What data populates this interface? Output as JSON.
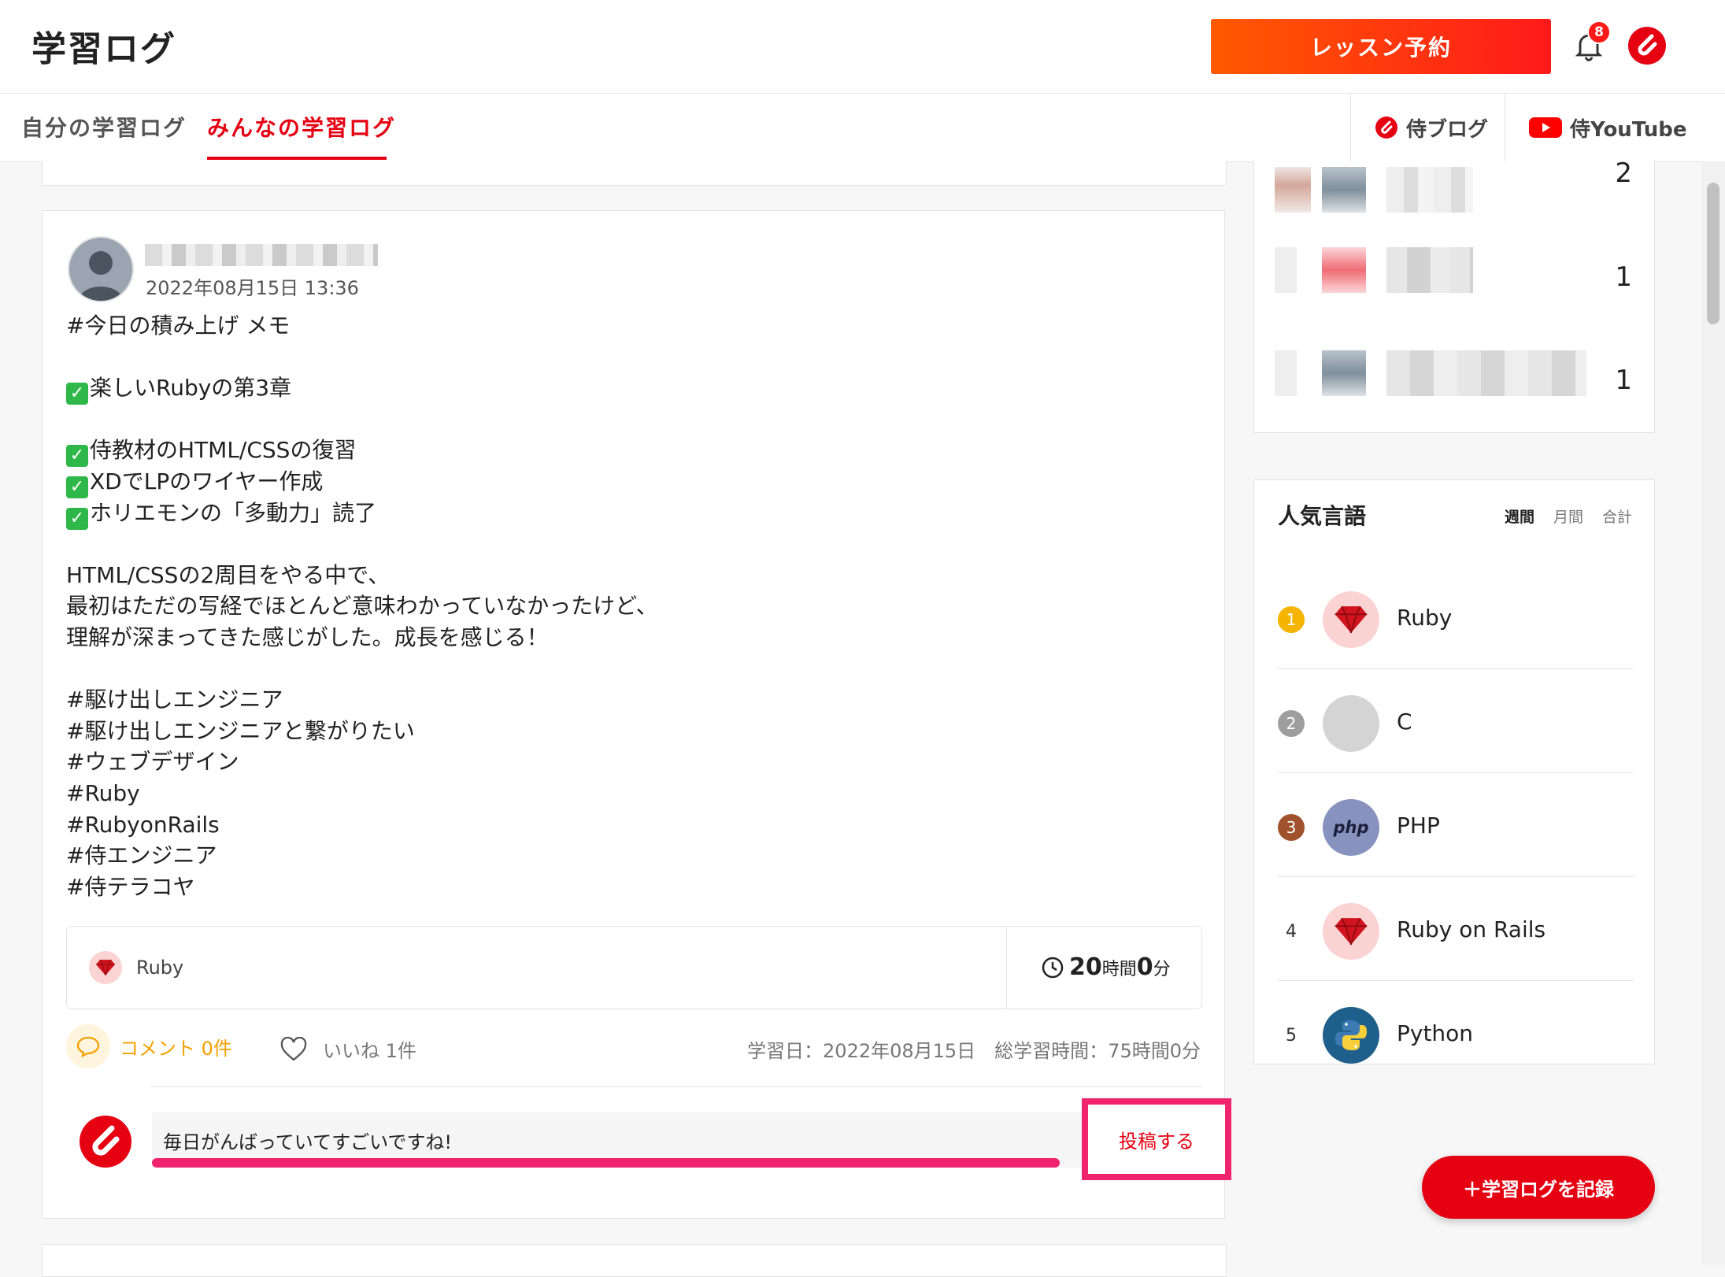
{
  "header": {
    "title": "学習ログ",
    "reserve_button": "レッスン予約",
    "notification_count": "8"
  },
  "tabs": {
    "mine": "自分の学習ログ",
    "everyone": "みんなの学習ログ",
    "active": "everyone"
  },
  "external_links": {
    "blog": "侍ブログ",
    "youtube": "侍YouTube"
  },
  "post": {
    "date": "2022年08月15日 13:36",
    "lines": [
      "#今日の積み上げ メモ",
      "",
      "✅楽しいRubyの第3章",
      "",
      "✅侍教材のHTML/CSSの復習",
      "✅XDでLPのワイヤー作成",
      "✅ホリエモンの「多動力」読了",
      "",
      "HTML/CSSの2周目をやる中で、",
      "最初はただの写経でほとんど意味わかっていなかったけど、",
      "理解が深まってきた感じがした。成長を感じる！",
      "",
      "#駆け出しエンジニア",
      "#駆け出しエンジニアと繋がりたい",
      "#ウェブデザイン",
      "#Ruby",
      "#RubyonRails",
      "#侍エンジニア",
      "#侍テラコヤ"
    ],
    "language": "Ruby",
    "duration_hours": "20",
    "duration_hours_unit": "時間",
    "duration_minutes": "0",
    "duration_minutes_unit": "分",
    "comment_label": "コメント 0件",
    "like_label": "いいね 1件",
    "study_meta": "学習日：2022年08月15日　総学習時間：75時間0分"
  },
  "comment_form": {
    "value": "毎日がんばっていてすごいですね!",
    "submit": "投稿する"
  },
  "ranking_counts": [
    "2",
    "1",
    "1"
  ],
  "popular": {
    "title": "人気言語",
    "periods": [
      "週間",
      "月間",
      "合計"
    ],
    "active_period": "週間",
    "items": [
      {
        "rank": "1",
        "name": "Ruby",
        "badge_color": "#f5b400"
      },
      {
        "rank": "2",
        "name": "C",
        "badge_color": "#9e9e9e"
      },
      {
        "rank": "3",
        "name": "PHP",
        "badge_color": "#a0522d"
      },
      {
        "rank": "4",
        "name": "Ruby on Rails"
      },
      {
        "rank": "5",
        "name": "Python"
      }
    ]
  },
  "record_button": "＋学習ログを記録",
  "colors": {
    "brand_red": "#e50012",
    "highlight_pink": "#f0246e",
    "comment_orange": "#f5a000"
  }
}
